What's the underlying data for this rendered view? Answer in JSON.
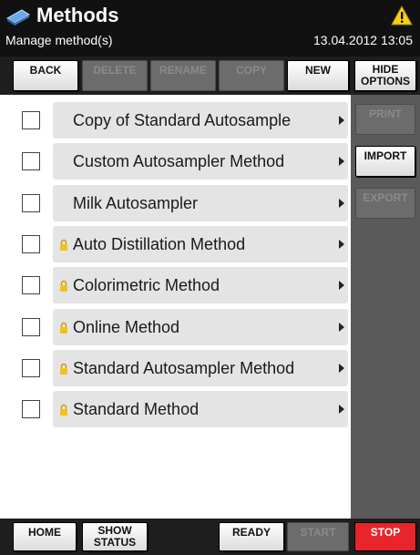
{
  "header": {
    "title": "Methods",
    "subtitle": "Manage method(s)",
    "datetime": "13.04.2012 13:05",
    "app_icon": "book-icon",
    "status_icon": "warning-icon"
  },
  "toolbar": {
    "back": "BACK",
    "delete": "DELETE",
    "rename": "RENAME",
    "copy": "COPY",
    "new": "NEW",
    "hide_options_line1": "HIDE",
    "hide_options_line2": "OPTIONS"
  },
  "side": {
    "print": "PRINT",
    "import": "IMPORT",
    "export": "EXPORT"
  },
  "methods": [
    {
      "label": "Copy of Standard Autosample",
      "locked": false,
      "checked": false
    },
    {
      "label": "Custom Autosampler Method",
      "locked": false,
      "checked": false
    },
    {
      "label": "Milk Autosampler",
      "locked": false,
      "checked": false
    },
    {
      "label": "Auto Distillation Method",
      "locked": true,
      "checked": false
    },
    {
      "label": "Colorimetric Method",
      "locked": true,
      "checked": false
    },
    {
      "label": "Online Method",
      "locked": true,
      "checked": false
    },
    {
      "label": "Standard Autosampler Method",
      "locked": true,
      "checked": false
    },
    {
      "label": "Standard Method",
      "locked": true,
      "checked": false
    }
  ],
  "bottom": {
    "home": "HOME",
    "show_status_line1": "SHOW",
    "show_status_line2": "STATUS",
    "ready": "READY",
    "start": "START",
    "stop": "STOP"
  },
  "colors": {
    "header_bg": "#111111",
    "stop_red": "#e8252a",
    "lock_yellow": "#f2c21b",
    "warning_yellow": "#f7d117"
  }
}
